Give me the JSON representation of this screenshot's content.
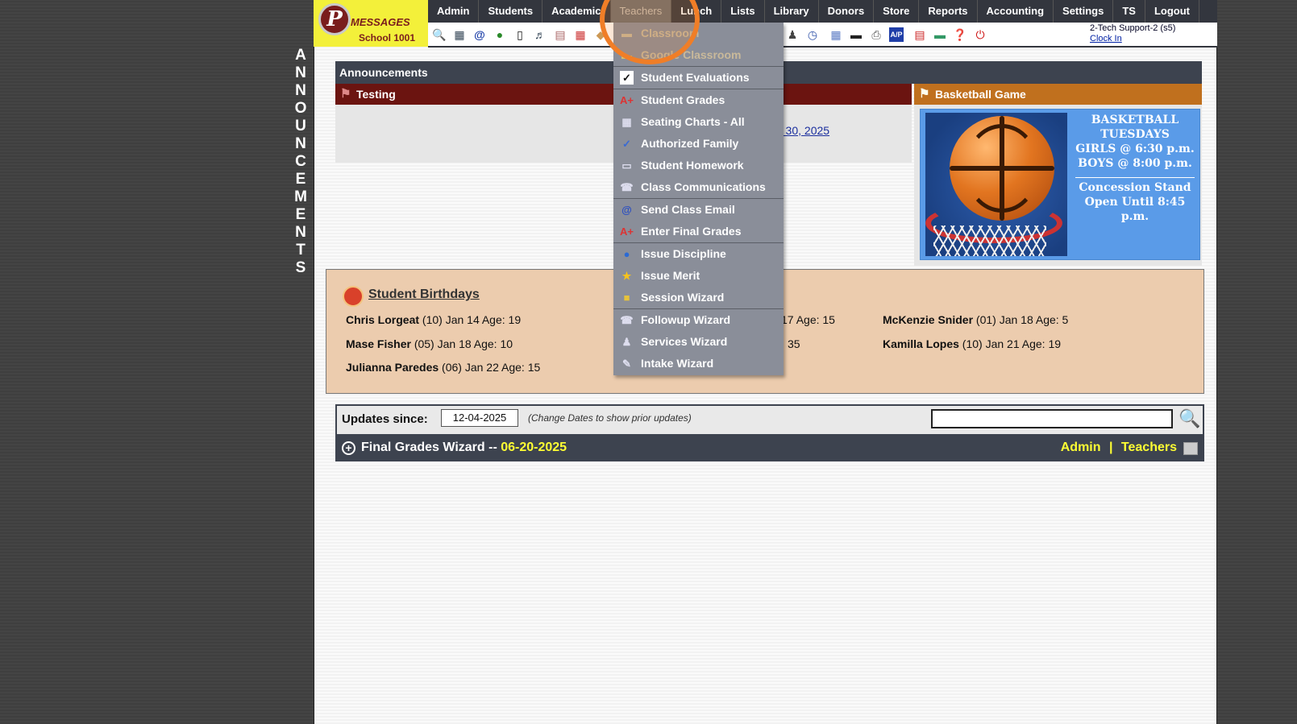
{
  "sidebar_vertical": [
    "A",
    "N",
    "N",
    "O",
    "U",
    "N",
    "C",
    "E",
    "M",
    "E",
    "N",
    "T",
    "S"
  ],
  "logo": {
    "letter": "P",
    "title": "MESSAGES",
    "subtitle": "School 1001"
  },
  "topnav": [
    "Admin",
    "Students",
    "Academic",
    "Teachers",
    "Lunch",
    "Lists",
    "Library",
    "Donors",
    "Store",
    "Reports",
    "Accounting",
    "Settings",
    "TS",
    "Logout"
  ],
  "topnav_active": "Teachers",
  "user": {
    "name": "2-Tech Support-2 (s5)",
    "clock_in": "Clock In"
  },
  "toolbar_icons": [
    "search-icon",
    "calendar-grid-icon",
    "email-at-icon",
    "chat-icon",
    "mobile-icon",
    "speaker-icon",
    "form-icon",
    "date-icon",
    "tag-icon",
    "group-icon",
    "person-icon",
    "clock-icon",
    "table-icon",
    "card-icon",
    "printer-icon",
    "ap-icon",
    "pdf-icon",
    "money-icon",
    "help-icon",
    "power-icon"
  ],
  "announcements": {
    "header": "Announcements",
    "testing": {
      "title": "Testing",
      "link_text": "r 30, 2025"
    },
    "basketball": {
      "title": "Basketball Game",
      "lines": [
        "BASKETBALL",
        "TUESDAYS",
        "GIRLS @ 6:30 p.m.",
        "BOYS  @ 8:00 p.m."
      ],
      "lines2": [
        "Concession Stand",
        "Open Until 8:45 p.m."
      ]
    }
  },
  "birthdays": {
    "title": "Student Birthdays",
    "entries": [
      {
        "name": "Chris Lorgeat",
        "detail": " (10) Jan 14 Age: 19"
      },
      {
        "name": "Mase Fisher",
        "detail": " (05) Jan 18 Age: 10"
      },
      {
        "name": "Julianna Paredes",
        "detail": " (06) Jan 22 Age: 15"
      },
      {
        "name": "",
        "detail": "17 Age: 15"
      },
      {
        "name": "",
        "detail": "35"
      },
      {
        "name": "McKenzie Snider",
        "detail": " (01) Jan 18 Age: 5"
      },
      {
        "name": "Kamilla Lopes",
        "detail": " (10) Jan 21 Age: 19"
      }
    ]
  },
  "updates": {
    "label": "Updates since:",
    "date": "12-04-2025",
    "note": "(Change Dates to show prior updates)",
    "search_placeholder": ""
  },
  "final_grades": {
    "title": "Final Grades Wizard",
    "sep": " -- ",
    "date": "06-20-2025",
    "admin": "Admin",
    "divider": "|",
    "teachers": "Teachers"
  },
  "dropdown": [
    {
      "label": "Classroom",
      "icon": "folder-icon",
      "dim": true
    },
    {
      "label": "Google Classroom",
      "icon": "google-classroom-icon",
      "dim": true
    },
    {
      "label": "Student Evaluations",
      "icon": "checkbox-icon"
    },
    {
      "label": "Student Grades",
      "icon": "grade-a-plus-icon"
    },
    {
      "label": "Seating Charts - All",
      "icon": "seating-grid-icon"
    },
    {
      "label": "Authorized Family",
      "icon": "checkmark-icon"
    },
    {
      "label": "Student Homework",
      "icon": "book-icon"
    },
    {
      "label": "Class Communications",
      "icon": "communications-icon"
    },
    {
      "label": "Send Class Email",
      "icon": "email-at-icon"
    },
    {
      "label": "Enter Final Grades",
      "icon": "grade-a-plus-icon"
    },
    {
      "label": "Issue Discipline",
      "icon": "discipline-badge-icon"
    },
    {
      "label": "Issue Merit",
      "icon": "merit-star-icon"
    },
    {
      "label": "Session Wizard",
      "icon": "session-icon"
    },
    {
      "label": "Followup Wizard",
      "icon": "followup-icon"
    },
    {
      "label": "Services Wizard",
      "icon": "services-icon"
    },
    {
      "label": "Intake Wizard",
      "icon": "intake-icon"
    }
  ]
}
